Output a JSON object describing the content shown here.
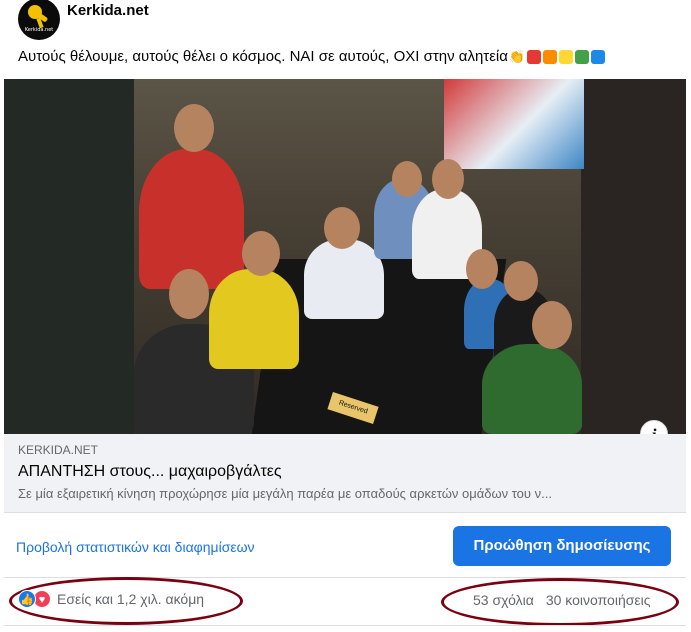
{
  "post": {
    "page_name": "Kerkida.net",
    "avatar_text": "Kerkida.net",
    "caption": "Αυτούς θέλουμε, αυτούς θέλει ο κόσμος. ΝΑΙ σε αυτούς, ΟΧΙ στην αλητεία",
    "caption_emoji": [
      "clap-emoji",
      "red-square",
      "orange-square",
      "yellow-square",
      "green-square",
      "blue-square"
    ],
    "emoji_colors": [
      "#e53935",
      "#fb8c00",
      "#fdd835",
      "#43a047",
      "#1e88e5"
    ]
  },
  "photo": {
    "sign_text": "Reserved",
    "info_label": "i"
  },
  "link_preview": {
    "domain": "KERKIDA.NET",
    "title": "ΑΠΑΝΤΗΣΗ στους... μαχαιροβγάλτες",
    "description": "Σε μία εξαιρετική κίνηση προχώρησε μία μεγάλη παρέα με οπαδούς αρκετών ομάδων του ν..."
  },
  "promo": {
    "insights_label": "Προβολή στατιστικών και διαφημίσεων",
    "boost_label": "Προώθηση δημοσίευσης"
  },
  "engagement": {
    "reactions_text": "Εσείς και 1,2 χιλ. ακόμη",
    "comments": "53 σχόλια",
    "shares": "30 κοινοποιήσεις"
  },
  "colors": {
    "accent": "#1b74e4",
    "annotation": "#7a0011",
    "like": "#1877f2",
    "love": "#f33e58"
  }
}
